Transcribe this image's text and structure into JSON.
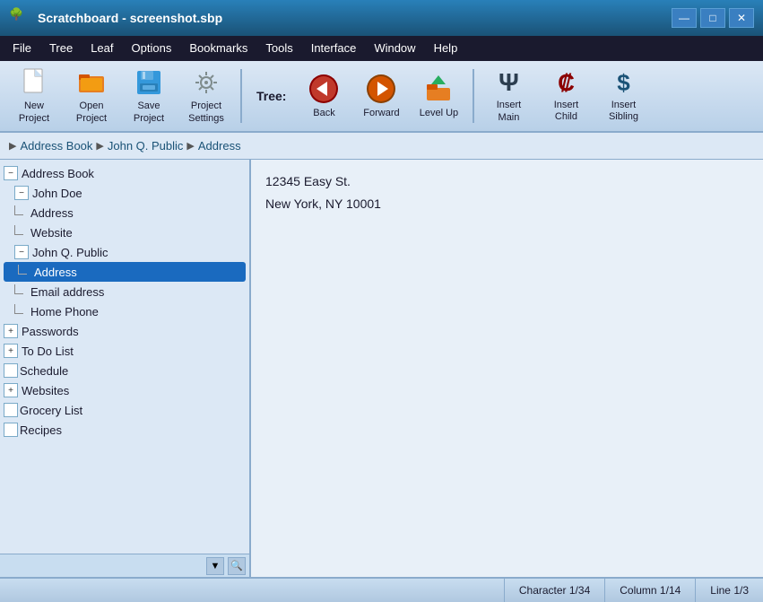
{
  "titleBar": {
    "title": "Scratchboard - screenshot.sbp",
    "icon": "🌳"
  },
  "winControls": {
    "minimize": "—",
    "maximize": "□",
    "close": "✕"
  },
  "menuBar": {
    "items": [
      {
        "label": "File",
        "underline": "F"
      },
      {
        "label": "Tree",
        "underline": "T"
      },
      {
        "label": "Leaf",
        "underline": "L"
      },
      {
        "label": "Options",
        "underline": "O"
      },
      {
        "label": "Bookmarks",
        "underline": "B"
      },
      {
        "label": "Tools",
        "underline": "T"
      },
      {
        "label": "Interface",
        "underline": "I"
      },
      {
        "label": "Window",
        "underline": "W"
      },
      {
        "label": "Help",
        "underline": "H"
      }
    ]
  },
  "toolbar": {
    "treeLabel": "Tree:",
    "buttons": [
      {
        "label": "New\nProject",
        "icon": "📄",
        "name": "new-project-button"
      },
      {
        "label": "Open\nProject",
        "icon": "📂",
        "name": "open-project-button"
      },
      {
        "label": "Save\nProject",
        "icon": "💾",
        "name": "save-project-button"
      },
      {
        "label": "Project\nSettings",
        "icon": "⚙",
        "name": "project-settings-button"
      },
      {
        "label": "Back",
        "icon": "←",
        "name": "back-button",
        "isNav": true
      },
      {
        "label": "Forward",
        "icon": "→",
        "name": "forward-button",
        "isNav": true
      },
      {
        "label": "Level Up",
        "icon": "📁",
        "name": "level-up-button",
        "isNav": true
      },
      {
        "label": "Insert\nMain",
        "icon": "Ψ",
        "name": "insert-main-button"
      },
      {
        "label": "Insert\nChild",
        "icon": "₡",
        "name": "insert-child-button"
      },
      {
        "label": "Insert\nSibling",
        "icon": "$",
        "name": "insert-sibling-button"
      }
    ]
  },
  "breadcrumb": {
    "items": [
      "Address Book",
      "John Q. Public",
      "Address"
    ]
  },
  "tree": {
    "items": [
      {
        "id": 1,
        "label": "Address Book",
        "level": 0,
        "type": "expanded",
        "selected": false
      },
      {
        "id": 2,
        "label": "John Doe",
        "level": 1,
        "type": "expanded-sub",
        "selected": false
      },
      {
        "id": 3,
        "label": "Address",
        "level": 2,
        "type": "leaf",
        "selected": false
      },
      {
        "id": 4,
        "label": "Website",
        "level": 2,
        "type": "leaf-last",
        "selected": false
      },
      {
        "id": 5,
        "label": "John Q. Public",
        "level": 1,
        "type": "expanded-sub",
        "selected": false
      },
      {
        "id": 6,
        "label": "Address",
        "level": 2,
        "type": "leaf",
        "selected": true
      },
      {
        "id": 7,
        "label": "Email address",
        "level": 2,
        "type": "leaf",
        "selected": false
      },
      {
        "id": 8,
        "label": "Home Phone",
        "level": 2,
        "type": "leaf-last",
        "selected": false
      },
      {
        "id": 9,
        "label": "Passwords",
        "level": 0,
        "type": "collapsed",
        "selected": false
      },
      {
        "id": 10,
        "label": "To Do List",
        "level": 0,
        "type": "collapsed",
        "selected": false
      },
      {
        "id": 11,
        "label": "Schedule",
        "level": 0,
        "type": "none",
        "selected": false
      },
      {
        "id": 12,
        "label": "Websites",
        "level": 0,
        "type": "collapsed",
        "selected": false
      },
      {
        "id": 13,
        "label": "Grocery List",
        "level": 0,
        "type": "none",
        "selected": false
      },
      {
        "id": 14,
        "label": "Recipes",
        "level": 0,
        "type": "none",
        "selected": false
      }
    ]
  },
  "content": {
    "lines": [
      "12345 Easy St.",
      "New York, NY 10001"
    ]
  },
  "statusBar": {
    "empty": "",
    "character": "Character 1/34",
    "column": "Column 1/14",
    "line": "Line 1/3"
  }
}
